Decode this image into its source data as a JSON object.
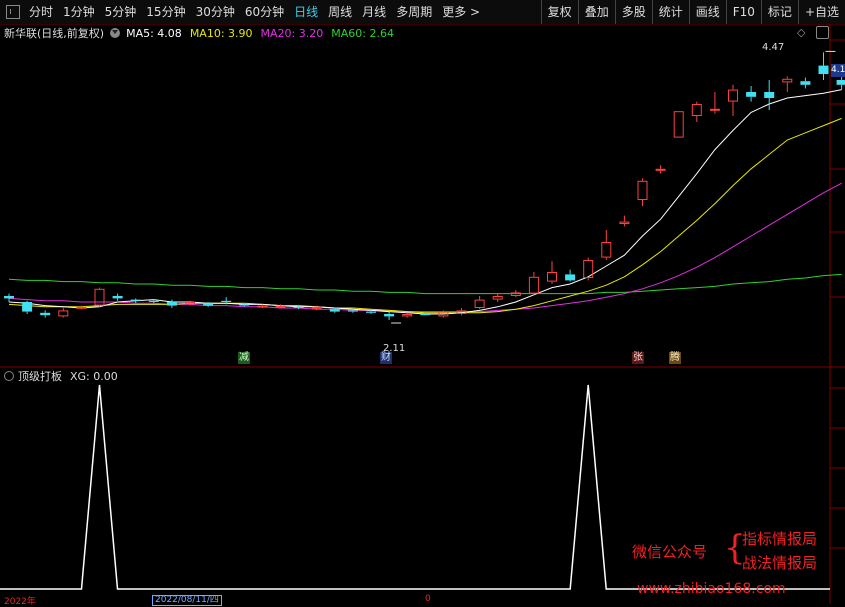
{
  "toolbar": {
    "periods": [
      "分时",
      "1分钟",
      "5分钟",
      "15分钟",
      "30分钟",
      "60分钟",
      "日线",
      "周线",
      "月线",
      "多周期",
      "更多 >"
    ],
    "active_period": "日线",
    "right_tools": [
      "复权",
      "叠加",
      "多股",
      "统计",
      "画线",
      "F10",
      "标记",
      "+自选"
    ]
  },
  "main_chart": {
    "title": "新华联(日线,前复权)",
    "ma": [
      {
        "label": "MA5: 4.08",
        "color": "#ffffff"
      },
      {
        "label": "MA10: 3.90",
        "color": "#e8e800"
      },
      {
        "label": "MA20: 3.20",
        "color": "#e030e0"
      },
      {
        "label": "MA60: 2.64",
        "color": "#30d030"
      }
    ],
    "high_label": "4.47",
    "low_label": "2.11",
    "price_tag": "4.1",
    "markers": {
      "jian": "减",
      "cai": "财",
      "zhang": "张",
      "teng": "腾"
    }
  },
  "sub_chart": {
    "title": "顶级打板",
    "value": "XG: 0.00",
    "signals_at_candle": [
      5,
      32
    ]
  },
  "watermark": {
    "left": "微信公众号",
    "brace": "{",
    "right1": "指标情报局",
    "right2": "战法情报局",
    "url": "www.zhibiao168.com"
  },
  "date_bar": {
    "left": "2022年",
    "mid": "2022/08/11/四",
    "right": "0"
  },
  "colors": {
    "up": "#ff4040",
    "down": "#40e0f0",
    "grid": "#800000",
    "signal": "#ffffff"
  },
  "chart_data": {
    "type": "candlestick",
    "ohlc": [
      [
        2.6,
        2.62,
        2.55,
        2.58
      ],
      [
        2.55,
        2.56,
        2.45,
        2.47
      ],
      [
        2.46,
        2.48,
        2.42,
        2.44
      ],
      [
        2.43,
        2.5,
        2.42,
        2.48
      ],
      [
        2.5,
        2.52,
        2.49,
        2.51
      ],
      [
        2.52,
        2.67,
        2.51,
        2.66
      ],
      [
        2.6,
        2.62,
        2.56,
        2.58
      ],
      [
        2.57,
        2.58,
        2.54,
        2.56
      ],
      [
        2.56,
        2.57,
        2.54,
        2.55
      ],
      [
        2.55,
        2.57,
        2.5,
        2.52
      ],
      [
        2.53,
        2.56,
        2.52,
        2.55
      ],
      [
        2.54,
        2.55,
        2.51,
        2.52
      ],
      [
        2.56,
        2.59,
        2.53,
        2.55
      ],
      [
        2.53,
        2.54,
        2.51,
        2.52
      ],
      [
        2.52,
        2.53,
        2.5,
        2.52
      ],
      [
        2.51,
        2.53,
        2.5,
        2.52
      ],
      [
        2.51,
        2.52,
        2.49,
        2.5
      ],
      [
        2.5,
        2.52,
        2.48,
        2.51
      ],
      [
        2.49,
        2.5,
        2.46,
        2.47
      ],
      [
        2.48,
        2.49,
        2.46,
        2.47
      ],
      [
        2.47,
        2.48,
        2.45,
        2.46
      ],
      [
        2.45,
        2.47,
        2.4,
        2.43
      ],
      [
        2.43,
        2.46,
        2.42,
        2.45
      ],
      [
        2.45,
        2.46,
        2.44,
        2.44
      ],
      [
        2.43,
        2.48,
        2.42,
        2.47
      ],
      [
        2.45,
        2.5,
        2.44,
        2.48
      ],
      [
        2.5,
        2.6,
        2.49,
        2.57
      ],
      [
        2.57,
        2.62,
        2.55,
        2.6
      ],
      [
        2.6,
        2.65,
        2.59,
        2.63
      ],
      [
        2.62,
        2.8,
        2.61,
        2.76
      ],
      [
        2.72,
        2.89,
        2.7,
        2.8
      ],
      [
        2.78,
        2.82,
        2.72,
        2.73
      ],
      [
        2.75,
        2.92,
        2.73,
        2.9
      ],
      [
        2.92,
        3.15,
        2.9,
        3.05
      ],
      [
        3.2,
        3.27,
        3.18,
        3.22
      ],
      [
        3.4,
        3.58,
        3.35,
        3.56
      ],
      [
        3.66,
        3.69,
        3.62,
        3.66
      ],
      [
        3.92,
        4.14,
        3.92,
        4.14
      ],
      [
        4.1,
        4.22,
        4.05,
        4.2
      ],
      [
        4.16,
        4.3,
        4.12,
        4.16
      ],
      [
        4.22,
        4.36,
        4.1,
        4.32
      ],
      [
        4.3,
        4.35,
        4.22,
        4.26
      ],
      [
        4.3,
        4.4,
        4.15,
        4.25
      ],
      [
        4.38,
        4.43,
        4.3,
        4.41
      ],
      [
        4.39,
        4.42,
        4.33,
        4.36
      ],
      [
        4.52,
        4.63,
        4.4,
        4.45
      ],
      [
        4.4,
        4.53,
        4.32,
        4.36
      ]
    ],
    "ma5": [
      2.55,
      2.54,
      2.52,
      2.51,
      2.5,
      2.51,
      2.55,
      2.56,
      2.57,
      2.55,
      2.55,
      2.54,
      2.54,
      2.53,
      2.53,
      2.52,
      2.51,
      2.51,
      2.5,
      2.49,
      2.48,
      2.47,
      2.46,
      2.45,
      2.45,
      2.46,
      2.48,
      2.51,
      2.55,
      2.61,
      2.67,
      2.7,
      2.76,
      2.85,
      2.94,
      3.1,
      3.24,
      3.43,
      3.62,
      3.82,
      3.98,
      4.13,
      4.2,
      4.25,
      4.27,
      4.29,
      4.32
    ],
    "ma10": [
      2.53,
      2.52,
      2.51,
      2.51,
      2.51,
      2.52,
      2.53,
      2.53,
      2.53,
      2.53,
      2.54,
      2.54,
      2.54,
      2.54,
      2.53,
      2.52,
      2.52,
      2.51,
      2.5,
      2.5,
      2.49,
      2.48,
      2.47,
      2.46,
      2.46,
      2.46,
      2.46,
      2.47,
      2.49,
      2.52,
      2.56,
      2.6,
      2.64,
      2.69,
      2.76,
      2.86,
      2.97,
      3.1,
      3.23,
      3.37,
      3.52,
      3.66,
      3.78,
      3.9,
      3.96,
      4.02,
      4.08
    ],
    "ma20": [
      2.58,
      2.57,
      2.56,
      2.56,
      2.55,
      2.55,
      2.55,
      2.54,
      2.54,
      2.53,
      2.53,
      2.52,
      2.52,
      2.51,
      2.51,
      2.5,
      2.5,
      2.49,
      2.49,
      2.48,
      2.48,
      2.48,
      2.47,
      2.47,
      2.47,
      2.47,
      2.47,
      2.48,
      2.49,
      2.5,
      2.52,
      2.54,
      2.56,
      2.59,
      2.62,
      2.66,
      2.71,
      2.77,
      2.84,
      2.92,
      3.01,
      3.1,
      3.19,
      3.28,
      3.37,
      3.46,
      3.54
    ],
    "ma60": [
      2.74,
      2.73,
      2.73,
      2.72,
      2.72,
      2.71,
      2.71,
      2.7,
      2.7,
      2.69,
      2.69,
      2.68,
      2.68,
      2.67,
      2.67,
      2.66,
      2.66,
      2.65,
      2.65,
      2.64,
      2.64,
      2.63,
      2.63,
      2.62,
      2.62,
      2.62,
      2.62,
      2.62,
      2.62,
      2.62,
      2.62,
      2.62,
      2.62,
      2.63,
      2.63,
      2.64,
      2.65,
      2.66,
      2.67,
      2.68,
      2.7,
      2.71,
      2.72,
      2.74,
      2.75,
      2.77,
      2.78
    ],
    "ylim": [
      2.05,
      4.75
    ]
  }
}
